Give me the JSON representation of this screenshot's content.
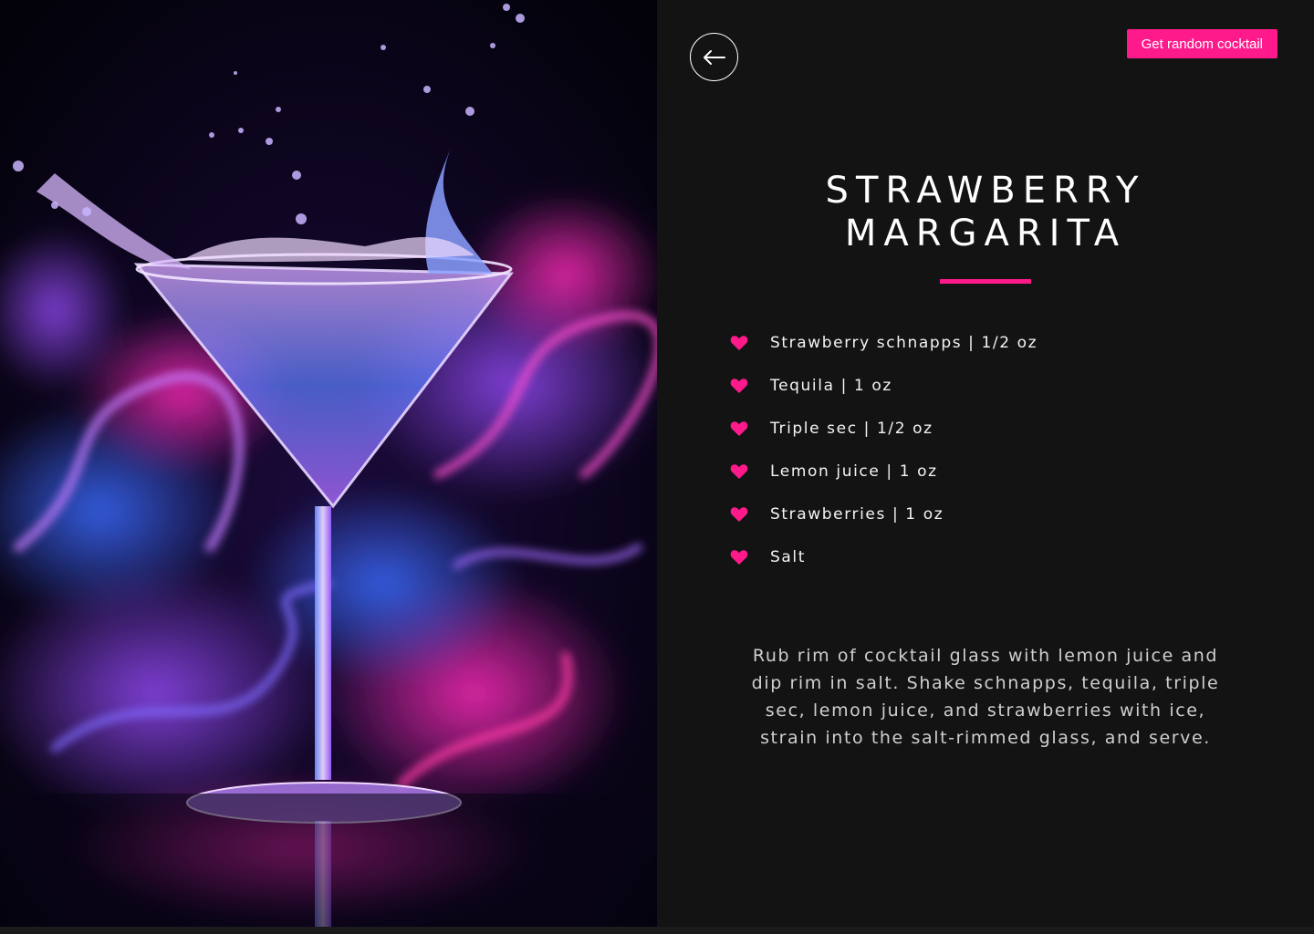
{
  "nav": {
    "back_icon": "arrow-left-icon",
    "random_button_label": "Get random cocktail"
  },
  "hero_image": {
    "subject": "martini glass splash with blue and pink smoke"
  },
  "cocktail": {
    "title_line1": "STRAWBERRY",
    "title_line2": "MARGARITA",
    "ingredients": [
      {
        "icon": "heart-icon",
        "text": "Strawberry schnapps | 1/2 oz"
      },
      {
        "icon": "heart-icon",
        "text": "Tequila | 1 oz"
      },
      {
        "icon": "heart-icon",
        "text": "Triple sec | 1/2 oz"
      },
      {
        "icon": "heart-icon",
        "text": "Lemon juice | 1 oz"
      },
      {
        "icon": "heart-icon",
        "text": "Strawberries | 1 oz"
      },
      {
        "icon": "heart-icon",
        "text": "Salt"
      }
    ],
    "instructions": "Rub rim of cocktail glass with lemon juice and dip rim in salt. Shake schnapps, tequila, triple sec, lemon juice, and strawberries with ice, strain into the salt-rimmed glass, and serve."
  },
  "colors": {
    "accent": "#ff1a8c",
    "background": "#131313",
    "text": "#ffffff",
    "muted_text": "#cfcfcf"
  }
}
